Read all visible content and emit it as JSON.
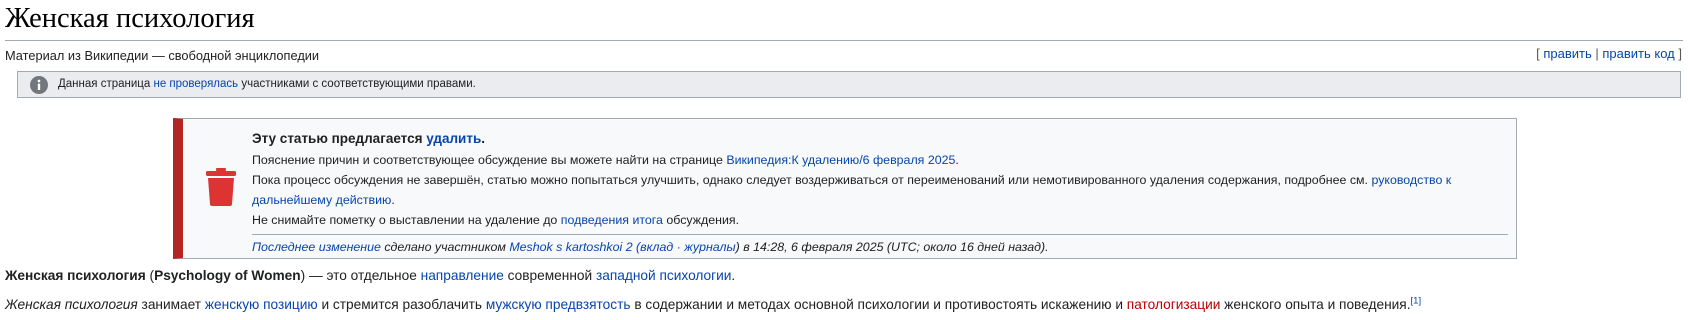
{
  "page": {
    "title": "Женская психология",
    "tagline": "Материал из Википедии — свободной энциклопедии",
    "edit_links": {
      "open": "[ ",
      "edit": "править",
      "divider": " | ",
      "edit_source": "править код",
      "close": " ]"
    }
  },
  "unreviewed_notice": {
    "icon": "info-icon",
    "text_before": "Данная страница ",
    "link": "не проверялась",
    "text_after": " участниками с соответствующими правами."
  },
  "deletion_notice": {
    "icon": "trash-icon",
    "accent_color": "#b32424",
    "heading_text": "Эту статью предлагается ",
    "heading_link": "удалить",
    "heading_end": ".",
    "line1_text": "Пояснение причин и соответствующее обсуждение вы можете найти на странице ",
    "line1_link": "Википедия:К удалению/6 февраля 2025",
    "line1_end": ".",
    "line2_text": "Пока процесс обсуждения не завершён, статью можно попытаться улучшить, однако следует воздерживаться от переименований или немотивированного удаления содержания, подробнее см. ",
    "line2_link": "руководство к дальнейшему действию",
    "line2_end": ".",
    "line3_text": "Не снимайте пометку о выставлении на удаление до ",
    "line3_link": "подведения итога",
    "line3_end": " обсуждения.",
    "meta_link_last_change": "Последнее изменение",
    "meta_text1": " сделано участником ",
    "meta_user": "Meshok s kartoshkoi 2",
    "meta_paren_open": " (",
    "meta_contrib": "вклад",
    "meta_dot": " · ",
    "meta_logs": "журналы",
    "meta_text2": ") в 14:28, 6 февраля 2025 (UTC; около 16 дней назад)."
  },
  "article": {
    "p1": {
      "bold1": "Женская психология",
      "t1": " (",
      "bold2": "Psychology of Women",
      "t2": ") — это отдельное ",
      "link1": "направление",
      "t3": " современной ",
      "link2": "западной психологии",
      "t4": "."
    },
    "p2": {
      "italic1": "Женская психология",
      "t1": " занимает ",
      "link1": "женскую позицию",
      "t2": " и стремится разоблачить ",
      "link2": "мужскую предвзятость",
      "t3": " в содержании и методах основной психологии и противостоять искажению и ",
      "redlink": "патологизации",
      "t4": " женского опыта и поведения.",
      "ref": "[1]"
    }
  }
}
